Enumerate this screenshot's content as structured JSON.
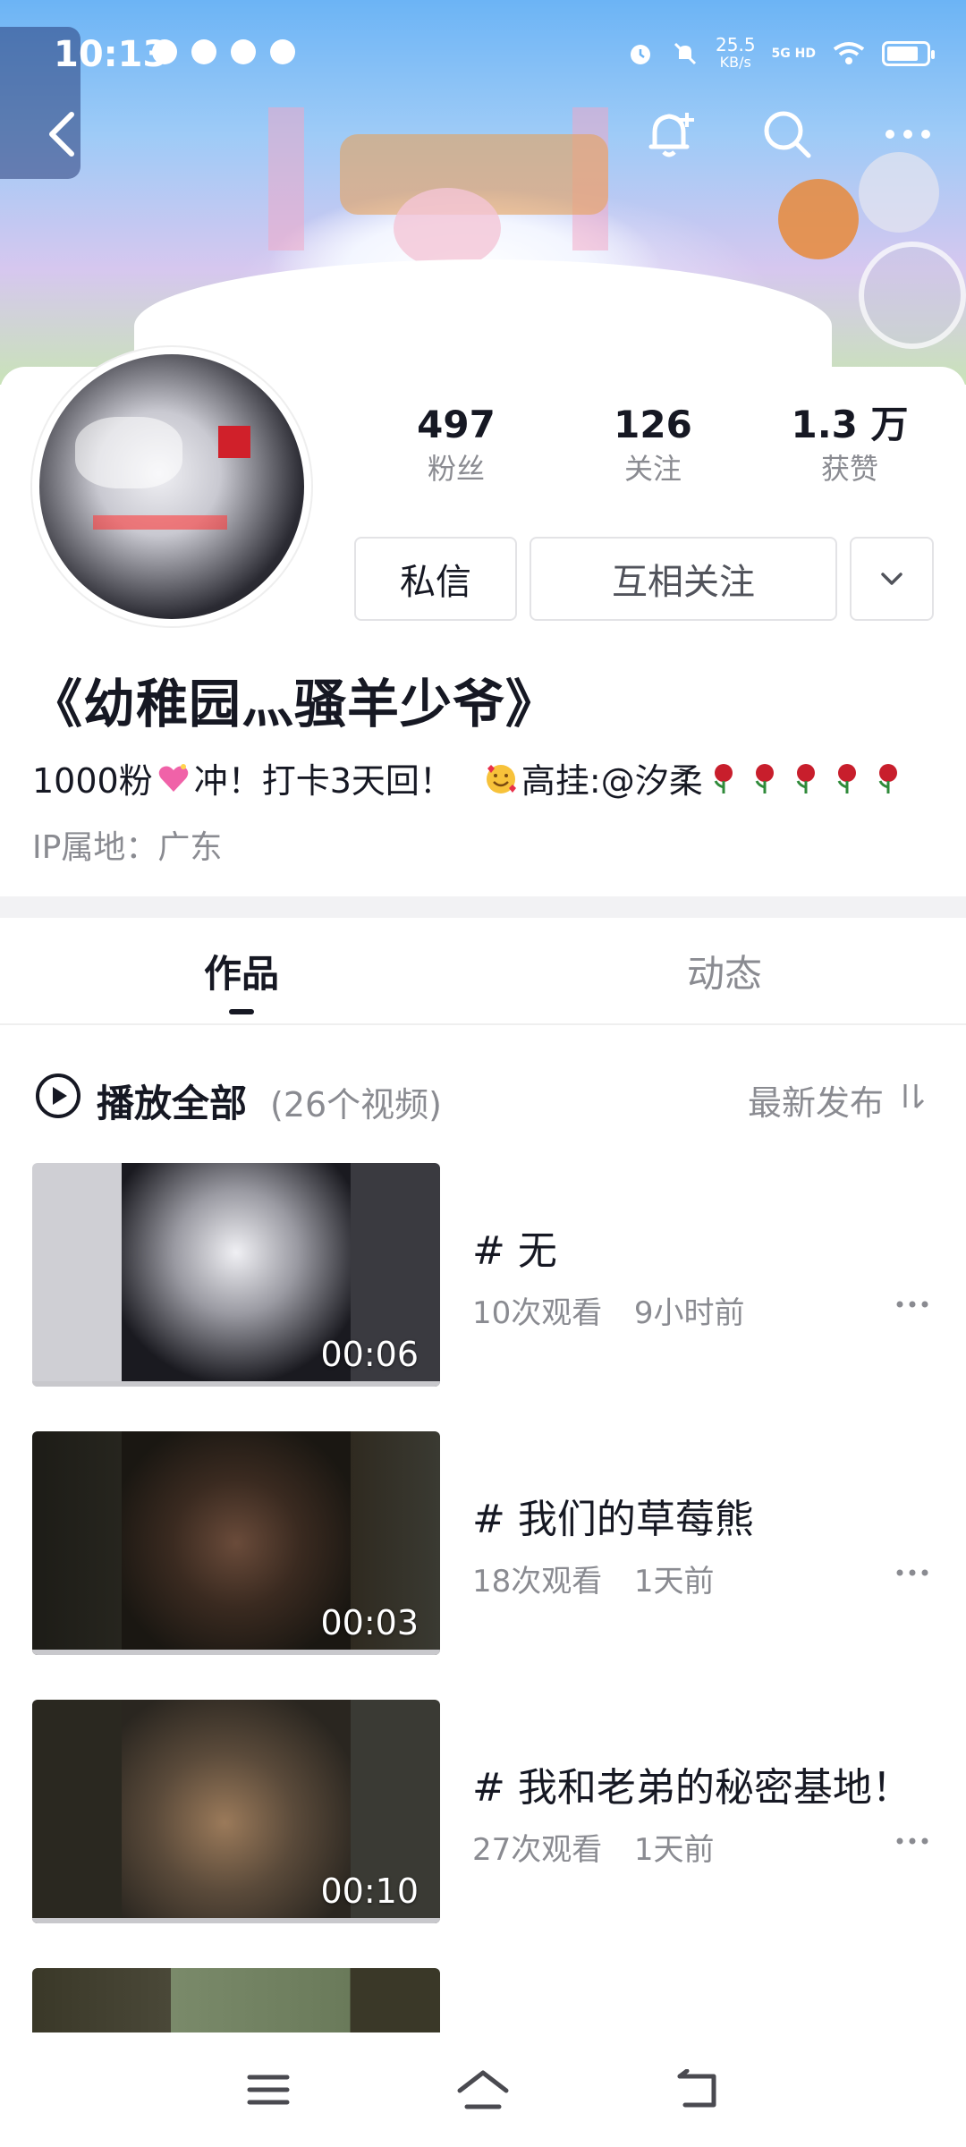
{
  "status_bar": {
    "time": "10:13",
    "net_speed_value": "25.5",
    "net_speed_unit": "KB/s",
    "network_type": "5G HD"
  },
  "profile": {
    "stats": [
      {
        "value": "497",
        "label": "粉丝"
      },
      {
        "value": "126",
        "label": "关注"
      },
      {
        "value": "1.3 万",
        "label": "获赞"
      }
    ],
    "message_button": "私信",
    "follow_button": "互相关注",
    "nickname": "《幼稚园灬骚羊少爷》",
    "bio_part1": "1000粉",
    "bio_part2": "冲！打卡3天回！",
    "bio_part3": "高挂:@汐柔",
    "ip_location": "IP属地：广东"
  },
  "tabs": {
    "works": "作品",
    "dynamic": "动态"
  },
  "play_all": {
    "label": "播放全部",
    "count": "(26个视频)",
    "sort_label": "最新发布"
  },
  "videos": [
    {
      "title": "# 无",
      "views": "10次观看",
      "time": "9小时前",
      "duration": "00:06"
    },
    {
      "title": "# 我们的草莓熊",
      "views": "18次观看",
      "time": "1天前",
      "duration": "00:03"
    },
    {
      "title": "# 我和老弟的秘密基地！",
      "views": "27次观看",
      "time": "1天前",
      "duration": "00:10"
    }
  ],
  "colors": {
    "text_primary": "#161823",
    "text_secondary": "#8a8b91",
    "border": "#e3e3e6"
  }
}
